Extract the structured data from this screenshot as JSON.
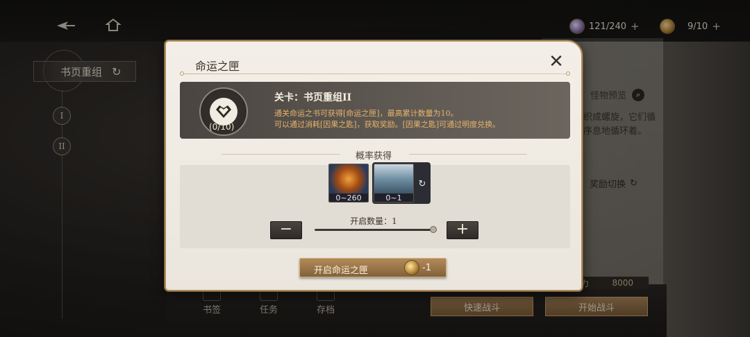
{
  "topbar": {
    "stamina": "121/240",
    "currency": "9/10",
    "plus": "+"
  },
  "left_panel": {
    "title": "书页重组",
    "refresh_icon": "↻",
    "stages": [
      "I",
      "II"
    ]
  },
  "background": {
    "monster_preview": "怪物预览",
    "bg_text_line1": "织成螺旋，它们循",
    "bg_text_line2": "序息地循环着。",
    "reward_switch": "奖励切换",
    "power_label": "力",
    "power_value": "8000",
    "quick_battle": "快速战斗",
    "start_battle": "开始战斗",
    "bottom_nav": [
      "书签",
      "任务",
      "存档"
    ]
  },
  "modal": {
    "title": "命运之匣",
    "close_icon": "✕",
    "stage": {
      "name": "关卡：书页重组II",
      "count": "(0/10)",
      "desc_line1": "通关命运之书可获得[命运之匣]，最高累计数量为10。",
      "desc_line2": "可以通过消耗[因果之匙]，获取奖励。[因果之匙]可通过明度兑换。"
    },
    "probability_title": "概率获得",
    "rewards": [
      {
        "icon": "orange-orb-icon",
        "qty": "0~260"
      },
      {
        "icon": "pillar-item-icon",
        "qty": "0~1"
      }
    ],
    "refresh_icon": "↻",
    "open_qty_label": "开启数量：1",
    "open_qty_level": 1.0,
    "minus": "−",
    "plus": "+",
    "open_button": {
      "label": "开启命运之匣",
      "cost": "-1"
    }
  }
}
